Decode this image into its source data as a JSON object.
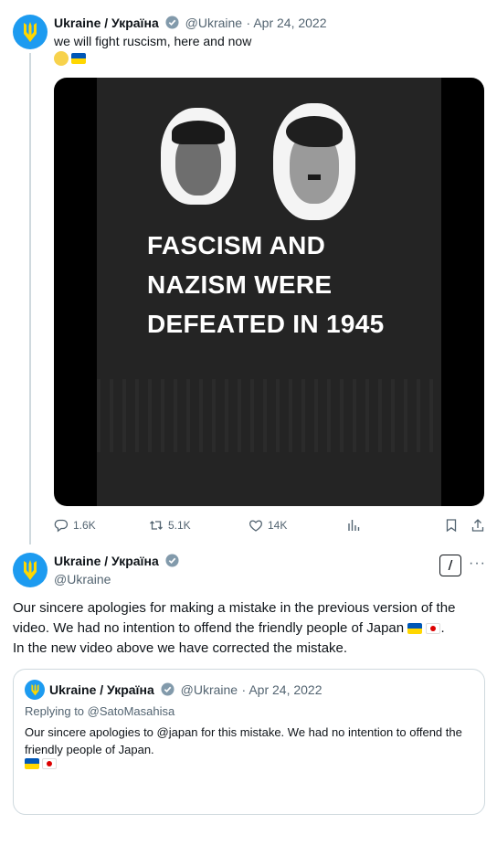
{
  "tweet1": {
    "name": "Ukraine / Україна",
    "handle": "@Ukraine",
    "date": "· Apr 24, 2022",
    "text": "we will fight ruscism, here and now",
    "media": {
      "caption": "FASCISM AND\nNAZISM WERE\nDEFEATED IN 1945"
    },
    "actions": {
      "replies": "1.6K",
      "retweets": "5.1K",
      "likes": "14K"
    }
  },
  "tweet2": {
    "name": "Ukraine / Україна",
    "handle": "@Ukraine",
    "grok_label": "/",
    "more_label": "···",
    "text": "Our sincere apologies for making a mistake in the previous version of the video. We had no intention to offend the friendly people of Japan",
    "text_end": ".\nIn the new video above we have corrected the mistake."
  },
  "quote": {
    "name": "Ukraine / Україна",
    "handle": "@Ukraine",
    "date": "· Apr 24, 2022",
    "replying": "Replying to @SatoMasahisa",
    "text": "Our sincere apologies to @japan for this mistake. We had no intention to offend the friendly people of Japan."
  },
  "colors": {
    "accent": "#1d9bf0",
    "muted": "#536471",
    "border": "#cfd9de",
    "flag_blue": "#0057b7",
    "flag_yellow": "#ffd700"
  },
  "icons": [
    "trident-icon",
    "verified-icon",
    "reply-icon",
    "retweet-icon",
    "like-icon",
    "views-icon",
    "bookmark-icon",
    "share-icon",
    "grok-icon",
    "more-icon"
  ]
}
